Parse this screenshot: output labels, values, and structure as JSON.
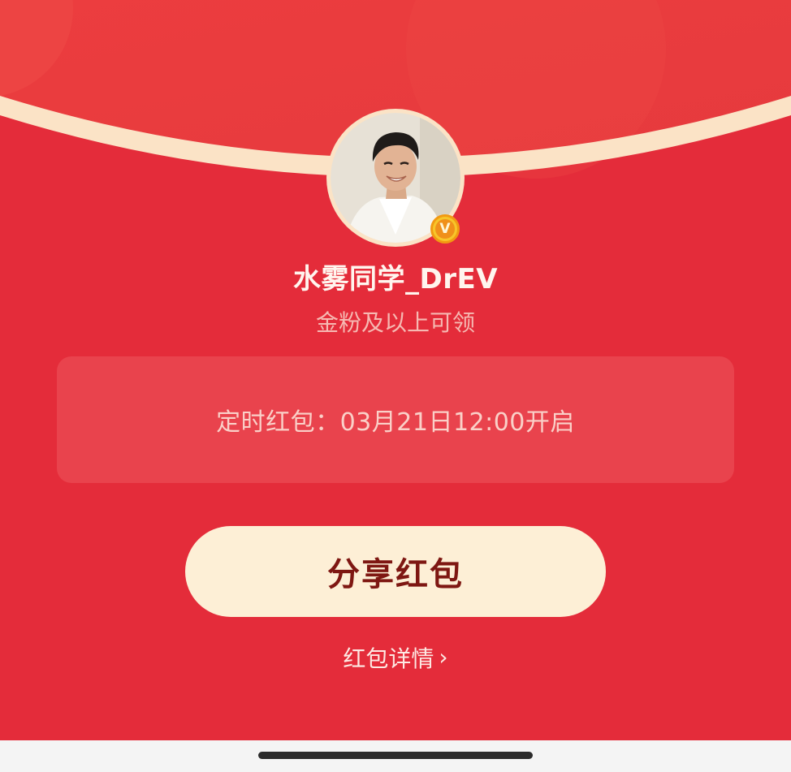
{
  "profile": {
    "username": "水雾同学_DrEV",
    "badge_letter": "V",
    "eligibility": "金粉及以上可领"
  },
  "timer": {
    "text": "定时红包：03月21日12:00开启"
  },
  "actions": {
    "share_label": "分享红包",
    "details_label": "红包详情",
    "details_chevron": "›"
  },
  "icons": {
    "verified": "verified-badge-icon",
    "chevron": "chevron-right-icon",
    "avatar": "avatar-photo"
  },
  "colors": {
    "background": "#e42c3a",
    "header_gradient_top": "#e8383f",
    "header_arc": "#fbe3c6",
    "button_bg": "#fdefd6",
    "button_text": "#7e1712",
    "timer_box": "#e9434d",
    "badge": "#f7c52a"
  }
}
